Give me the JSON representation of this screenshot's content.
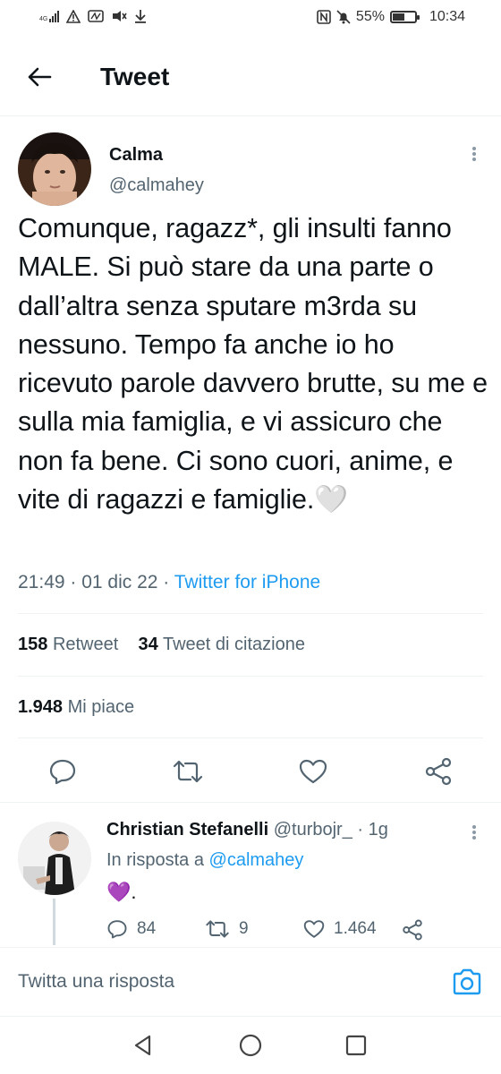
{
  "status_bar": {
    "network": "4G",
    "battery_percent": "55%",
    "battery_level": 0.55,
    "time": "10:34",
    "icons": [
      "signal-icon",
      "warning-icon",
      "nfc-icon",
      "mute-icon",
      "download-icon",
      "nfc-icon",
      "bell-off-icon",
      "battery-icon"
    ]
  },
  "header": {
    "title": "Tweet",
    "back_icon": "arrow-left-icon"
  },
  "tweet": {
    "author_name": "Calma",
    "author_handle": "@calmahey",
    "text": "Comunque, ragazz*, gli insulti fanno MALE. Si può stare da una parte o dall’altra senza sputare m3rda su nessuno. Tempo fa anche io ho ricevuto parole davvero brutte, su me e sulla mia famiglia, e vi assicuro che non fa bene. Ci sono cuori, anime, e vite di ragazzi e famiglie.",
    "emoji": "🤍",
    "time": "21:49",
    "date": "01 dic 22",
    "client": "Twitter for iPhone",
    "retweets_count": "158",
    "retweets_label": "Retweet",
    "quotes_count": "34",
    "quotes_label": "Tweet di citazione",
    "likes_count": "1.948",
    "likes_label": "Mi piace"
  },
  "reply": {
    "author_name": "Christian Stefanelli",
    "author_handle": "@turbojr_",
    "age": "1g",
    "in_reply_prefix": "In risposta a",
    "in_reply_mention": "@calmahey",
    "body_emoji": "💜",
    "body_suffix": ".",
    "replies": "84",
    "retweets": "9",
    "likes": "1.464"
  },
  "compose": {
    "placeholder": "Twitta una risposta",
    "camera_icon": "camera-icon"
  },
  "colors": {
    "accent": "#1d9bf0",
    "text": "#0f1419",
    "muted": "#536471",
    "divider": "#eff3f4"
  }
}
